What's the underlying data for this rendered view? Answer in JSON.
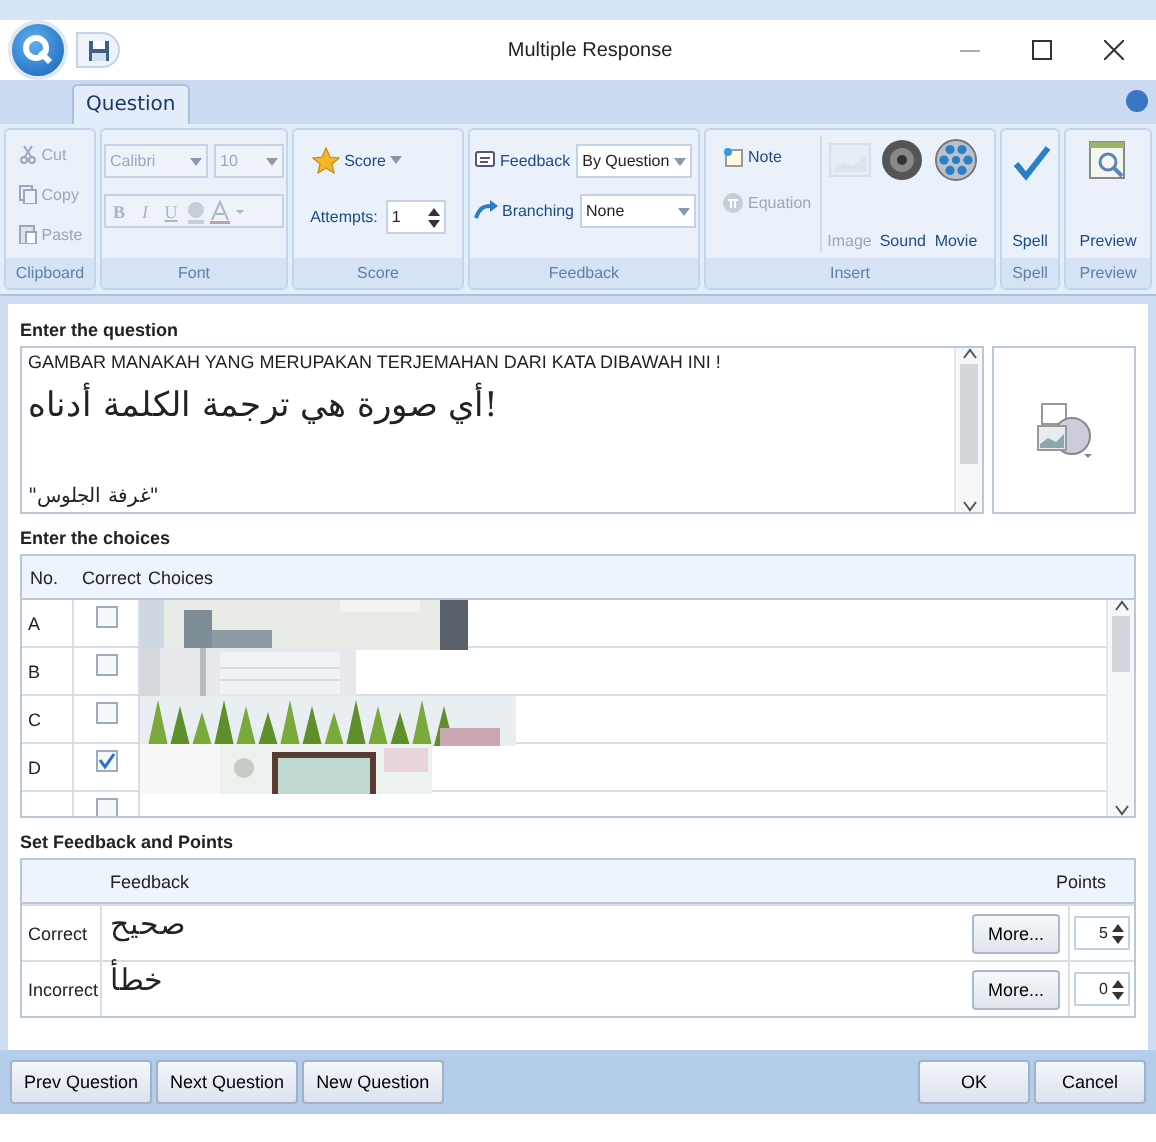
{
  "window": {
    "title": "Multiple Response"
  },
  "tabs": [
    {
      "label": "Question",
      "selected": true
    }
  ],
  "ribbon": {
    "groups": [
      {
        "label": "Clipboard",
        "kind": "clipboard",
        "items": [
          {
            "label": "Cut",
            "disabled": true
          },
          {
            "label": "Copy",
            "disabled": true
          },
          {
            "label": "Paste",
            "disabled": true
          }
        ]
      },
      {
        "label": "Font",
        "kind": "font",
        "font": "Calibri",
        "size": "10",
        "disabled": true,
        "styles": [
          "B",
          "I",
          "U"
        ]
      },
      {
        "label": "Score",
        "kind": "score",
        "score": "Score",
        "attempts_label": "Attempts:",
        "attempts": "1"
      },
      {
        "label": "Feedback",
        "kind": "feedback",
        "rows": [
          {
            "label": "Feedback",
            "value": "By Question"
          },
          {
            "label": "Branching",
            "value": "None"
          }
        ]
      },
      {
        "label": "Insert",
        "kind": "insert",
        "small": [
          {
            "label": "Note",
            "disabled": false
          },
          {
            "label": "Equation",
            "disabled": true
          }
        ],
        "large": [
          {
            "label": "Image",
            "disabled": true
          },
          {
            "label": "Sound",
            "disabled": false
          },
          {
            "label": "Movie",
            "disabled": false
          }
        ]
      },
      {
        "label": "Spell",
        "kind": "spell",
        "items": [
          {
            "label": "Spell"
          }
        ]
      },
      {
        "label": "Preview",
        "kind": "preview",
        "items": [
          {
            "label": "Preview"
          }
        ]
      }
    ]
  },
  "question": {
    "heading": "Enter the question",
    "lines": [
      {
        "text": "GAMBAR MANAKAH YANG MERUPAKAN TERJEMAHAN DARI KATA  DIBAWAH INI !",
        "kind": "latin"
      },
      {
        "text": "أي صورة هي ترجمة الكلمة أدناه!",
        "kind": "arabic"
      },
      {
        "text": "\"غرفة الجلوس\"",
        "kind": "small-arabic"
      }
    ]
  },
  "choices": {
    "heading": "Enter the choices",
    "columns": [
      "No.",
      "Correct",
      "Choices"
    ],
    "rows": [
      {
        "no": "A",
        "correct": false,
        "kind": "picture"
      },
      {
        "no": "B",
        "correct": false,
        "kind": "picture"
      },
      {
        "no": "C",
        "correct": false,
        "kind": "picture"
      },
      {
        "no": "D",
        "correct": true,
        "kind": "picture"
      },
      {
        "correct": false
      }
    ]
  },
  "feedback": {
    "heading": "Set Feedback and Points",
    "columns": [
      "Feedback",
      "Points"
    ],
    "rows": [
      {
        "label": "Correct",
        "text": "صحيح",
        "more": "More...",
        "points": "5"
      },
      {
        "label": "Incorrect",
        "text": "خطأ",
        "more": "More...",
        "points": "0"
      }
    ]
  },
  "buttons": {
    "left": [
      "Prev Question",
      "Next Question",
      "New Question"
    ],
    "right": [
      "OK",
      "Cancel"
    ]
  }
}
